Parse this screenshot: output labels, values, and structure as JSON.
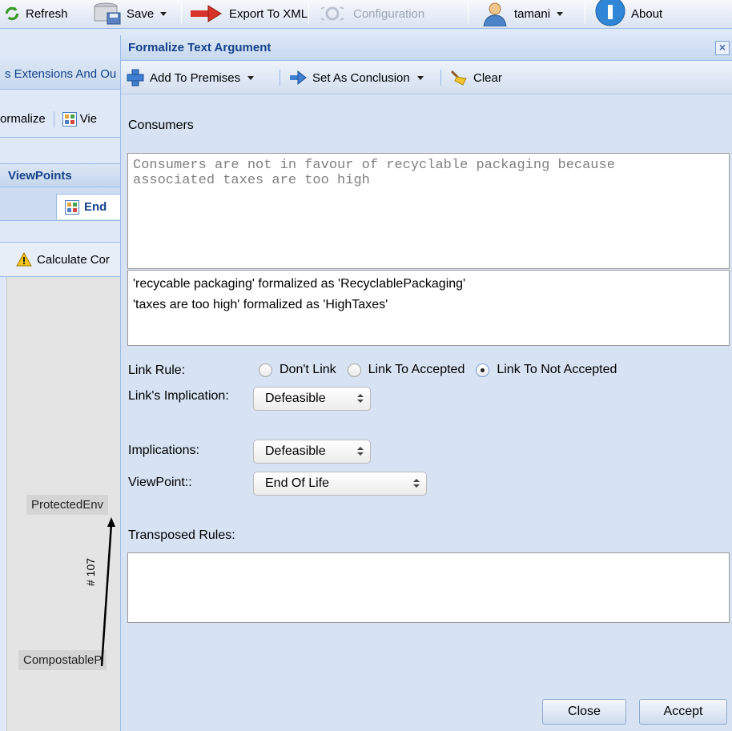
{
  "toolbar": {
    "refresh_label": "Refresh",
    "save_label": "Save",
    "export_label": "Export To XML",
    "configuration_label": "Configuration",
    "user_label": "tamani",
    "about_label": "About"
  },
  "background": {
    "extensions_tab": "s Extensions And Ou",
    "formalize_label": "ormalize",
    "view_label": "Vie",
    "viewpoints_title": "ViewPoints",
    "viewpoint_tab": "End",
    "calculate_label": "Calculate Cor",
    "node_top": "ProtectedEnv",
    "node_bottom": "CompostableP",
    "edge_label": "# 107"
  },
  "dialog": {
    "title": "Formalize Text Argument",
    "close_glyph": "×",
    "add_to_premises": "Add To Premises",
    "set_as_conclusion": "Set As Conclusion",
    "clear": "Clear",
    "argument_title": "Consumers",
    "argument_text": "Consumers are not in favour of recyclable packaging because\nassociated taxes are too high",
    "formalizations": [
      "'recycable packaging' formalized as 'RecyclablePackaging'",
      "'taxes are too high' formalized as 'HighTaxes'"
    ],
    "link_rule_label": "Link Rule:",
    "link_options": [
      "Don't Link",
      "Link To Accepted",
      "Link To Not Accepted"
    ],
    "link_selected": "Link To Not Accepted",
    "link_implication_label": "Link's Implication:",
    "link_implication_value": "Defeasible",
    "implications_label": "Implications:",
    "implications_value": "Defeasible",
    "viewpoint_label": "ViewPoint::",
    "viewpoint_value": "End Of Life",
    "transposed_label": "Transposed Rules:",
    "close_button": "Close",
    "accept_button": "Accept"
  },
  "colors": {
    "header_text": "#15428b",
    "panel_bg": "#d7e3f3",
    "border": "#99bbe8"
  }
}
